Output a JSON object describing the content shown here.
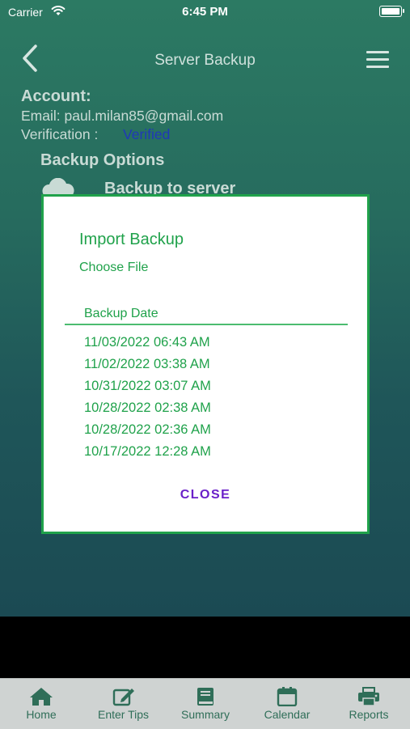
{
  "status_bar": {
    "carrier": "Carrier",
    "time": "6:45 PM"
  },
  "nav": {
    "title": "Server Backup",
    "back_icon": "chevron-left-icon",
    "menu_icon": "hamburger-menu-icon"
  },
  "account": {
    "heading": "Account:",
    "email_line": "Email: paul.milan85@gmail.com",
    "verification_label": "Verification :",
    "verification_value": "Verified"
  },
  "backup_options": {
    "heading": "Backup Options",
    "server_label": "Backup to server"
  },
  "modal": {
    "title": "Import Backup",
    "choose_file": "Choose File",
    "column_header": "Backup Date",
    "dates": [
      "11/03/2022 06:43 AM",
      "11/02/2022 03:38 AM",
      "10/31/2022 03:07 AM",
      "10/28/2022 02:38 AM",
      "10/28/2022 02:36 AM",
      "10/17/2022 12:28 AM"
    ],
    "close_label": "CLOSE"
  },
  "tabbar": {
    "items": [
      {
        "label": "Home",
        "icon": "home-icon"
      },
      {
        "label": "Enter Tips",
        "icon": "edit-icon"
      },
      {
        "label": "Summary",
        "icon": "book-icon"
      },
      {
        "label": "Calendar",
        "icon": "calendar-icon"
      },
      {
        "label": "Reports",
        "icon": "printer-icon"
      }
    ]
  },
  "colors": {
    "accent_green": "#20a24b",
    "verified_blue": "#1f38b8",
    "close_purple": "#6a20c9",
    "tab_icon_green": "#2f6e58"
  }
}
